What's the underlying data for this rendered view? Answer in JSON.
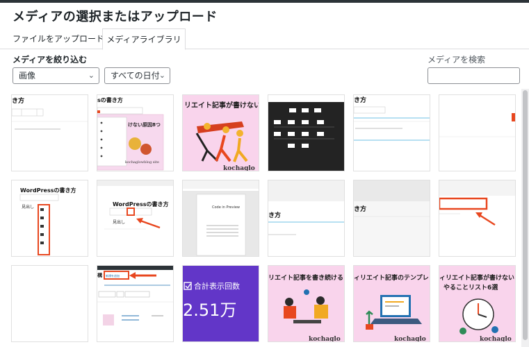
{
  "modal": {
    "title": "メディアの選択またはアップロード"
  },
  "tabs": [
    {
      "label": "ファイルをアップロード",
      "active": false
    },
    {
      "label": "メディアライブラリ",
      "active": true
    }
  ],
  "filters": {
    "label": "メディアを絞り込む",
    "type_select": "画像",
    "date_select": "すべての日付",
    "search_label": "メディアを検索",
    "search_value": ""
  },
  "thumbs": {
    "t1": {
      "heading": "き方"
    },
    "t2": {
      "heading": "sの書き方",
      "caption": "kochaglowblog site",
      "title": "けない原因8つ"
    },
    "t3": {
      "title": "リエイト記事が書けない原",
      "brand": "kochaglo"
    },
    "t5": {
      "heading": "き方"
    },
    "t7": {
      "heading": "WordPressの書き方",
      "sub": "見出し"
    },
    "t8": {
      "heading": "WordPressの書き方",
      "sub": "見出し"
    },
    "t9": {
      "heading": "Code in Preview"
    },
    "t10": {
      "heading": "き方"
    },
    "t11": {
      "heading": "き方"
    },
    "t14": {
      "heading": "構",
      "button": "新規を追加"
    },
    "t15": {
      "title": "合計表示回数",
      "value": "2.51万"
    },
    "t16": {
      "title": "リエイト記事を書き続ける",
      "brand": "kochaglo"
    },
    "t17": {
      "title": "ィリエイト記事のテンプレ",
      "brand": "kochaglo"
    },
    "t18": {
      "title": "ィリエイト記事が書けない",
      "title2": "やることリスト6選",
      "brand": "kochaglo"
    }
  },
  "colors": {
    "accent_red": "#e8471f",
    "pink_bg": "#f9d4ec",
    "purple_bg": "#6236c8",
    "dark_bg": "#232323",
    "yellow": "#f5b723",
    "blue": "#2271b1"
  }
}
